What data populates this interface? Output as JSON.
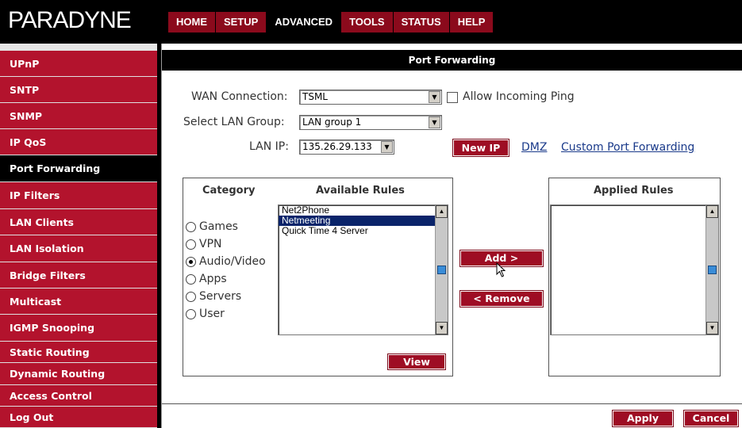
{
  "header": {
    "logo": "PARADYNE",
    "tabs": [
      "HOME",
      "SETUP",
      "ADVANCED",
      "TOOLS",
      "STATUS",
      "HELP"
    ],
    "active_tab": "ADVANCED"
  },
  "sidebar": {
    "items": [
      {
        "label": "UPnP"
      },
      {
        "label": "SNTP"
      },
      {
        "label": "SNMP"
      },
      {
        "label": "IP QoS"
      },
      {
        "label": "Port Forwarding"
      },
      {
        "label": "IP Filters"
      },
      {
        "label": "LAN Clients"
      },
      {
        "label": "LAN Isolation"
      },
      {
        "label": "Bridge Filters"
      },
      {
        "label": "Multicast"
      },
      {
        "label": "IGMP Snooping"
      },
      {
        "label": "Static Routing"
      },
      {
        "label": "Dynamic Routing"
      },
      {
        "label": "Access Control"
      },
      {
        "label": "Log Out"
      }
    ],
    "active_item": "Port Forwarding"
  },
  "page": {
    "title": "Port Forwarding",
    "wan_connection_label": "WAN Connection:",
    "wan_connection_value": "TSML",
    "allow_ping_label": "Allow Incoming Ping",
    "allow_ping_checked": false,
    "lan_group_label": "Select LAN Group:",
    "lan_group_value": "LAN group 1",
    "lan_ip_label": "LAN IP:",
    "lan_ip_value": "135.26.29.133",
    "new_ip_button": "New IP",
    "dmz_link": "DMZ",
    "custom_port_forwarding_link": "Custom Port Forwarding"
  },
  "rules": {
    "category_header": "Category",
    "available_header": "Available Rules",
    "applied_header": "Applied Rules",
    "categories": [
      {
        "label": "Games",
        "selected": false
      },
      {
        "label": "VPN",
        "selected": false
      },
      {
        "label": "Audio/Video",
        "selected": true
      },
      {
        "label": "Apps",
        "selected": false
      },
      {
        "label": "Servers",
        "selected": false
      },
      {
        "label": "User",
        "selected": false
      }
    ],
    "available": [
      {
        "label": "Net2Phone",
        "selected": false
      },
      {
        "label": "Netmeeting",
        "selected": true
      },
      {
        "label": "Quick Time 4 Server",
        "selected": false
      }
    ],
    "applied": [],
    "view_button": "View",
    "add_button": "Add >",
    "remove_button": "< Remove"
  },
  "footer": {
    "apply_button": "Apply",
    "cancel_button": "Cancel"
  },
  "colors": {
    "brand_red": "#b3132d",
    "dark_red": "#9e0d24",
    "black": "#000000",
    "link_blue": "#1a3a8a"
  }
}
